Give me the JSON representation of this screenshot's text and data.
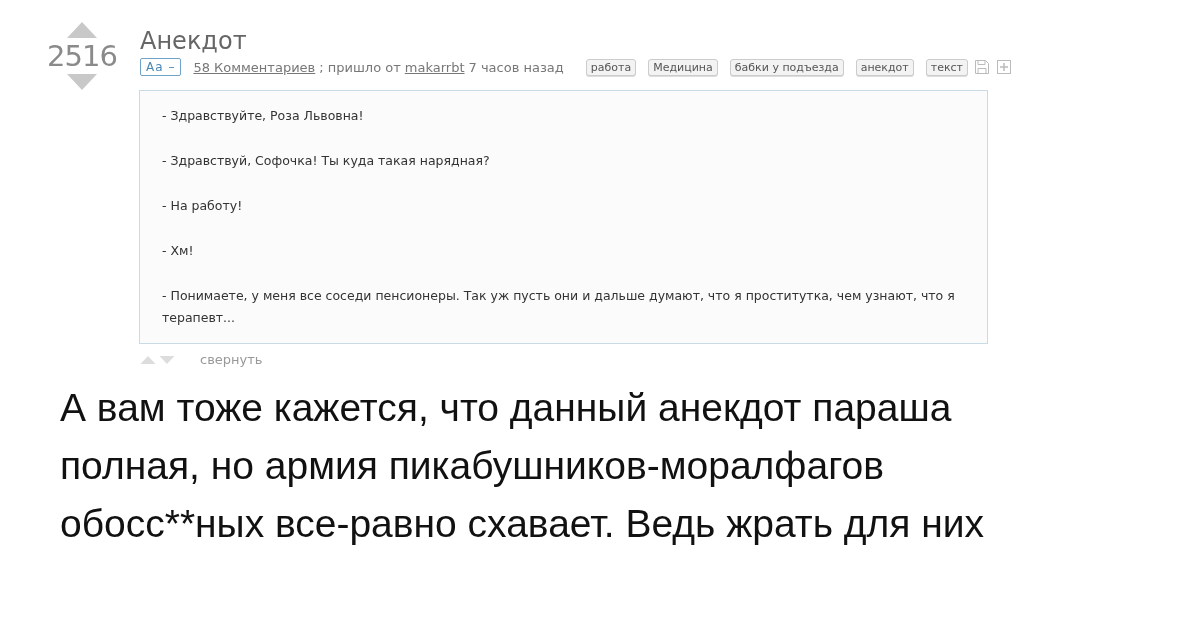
{
  "post": {
    "rating": "2516",
    "title": "Анекдот",
    "font_toggle": "Аа –",
    "comments_link": "58 Комментариев",
    "meta_text": "; пришло от",
    "author": "makarrbt",
    "time": "7 часов назад",
    "tags": [
      "работа",
      "Медицина",
      "бабки у подъезда",
      "анекдот",
      "текст"
    ],
    "paragraphs": [
      "- Здравствуйте, Роза Львовна!",
      "- Здравствуй, Софочка! Ты куда такая нарядная?",
      "- На работу!",
      "- Хм!",
      "- Понимаете, у меня все соседи пенсионеры. Так уж пусть они и дальше думают, что я проститутка, чем узнают, что я терапевт..."
    ],
    "collapse": "свернуть"
  },
  "caption_lines": [
    "А вам тоже кажется, что данный анекдот параша",
    "полная, но армия пикабушников-моралфагов",
    "обосс**ных все-равно схавает. Ведь жрать для них"
  ]
}
